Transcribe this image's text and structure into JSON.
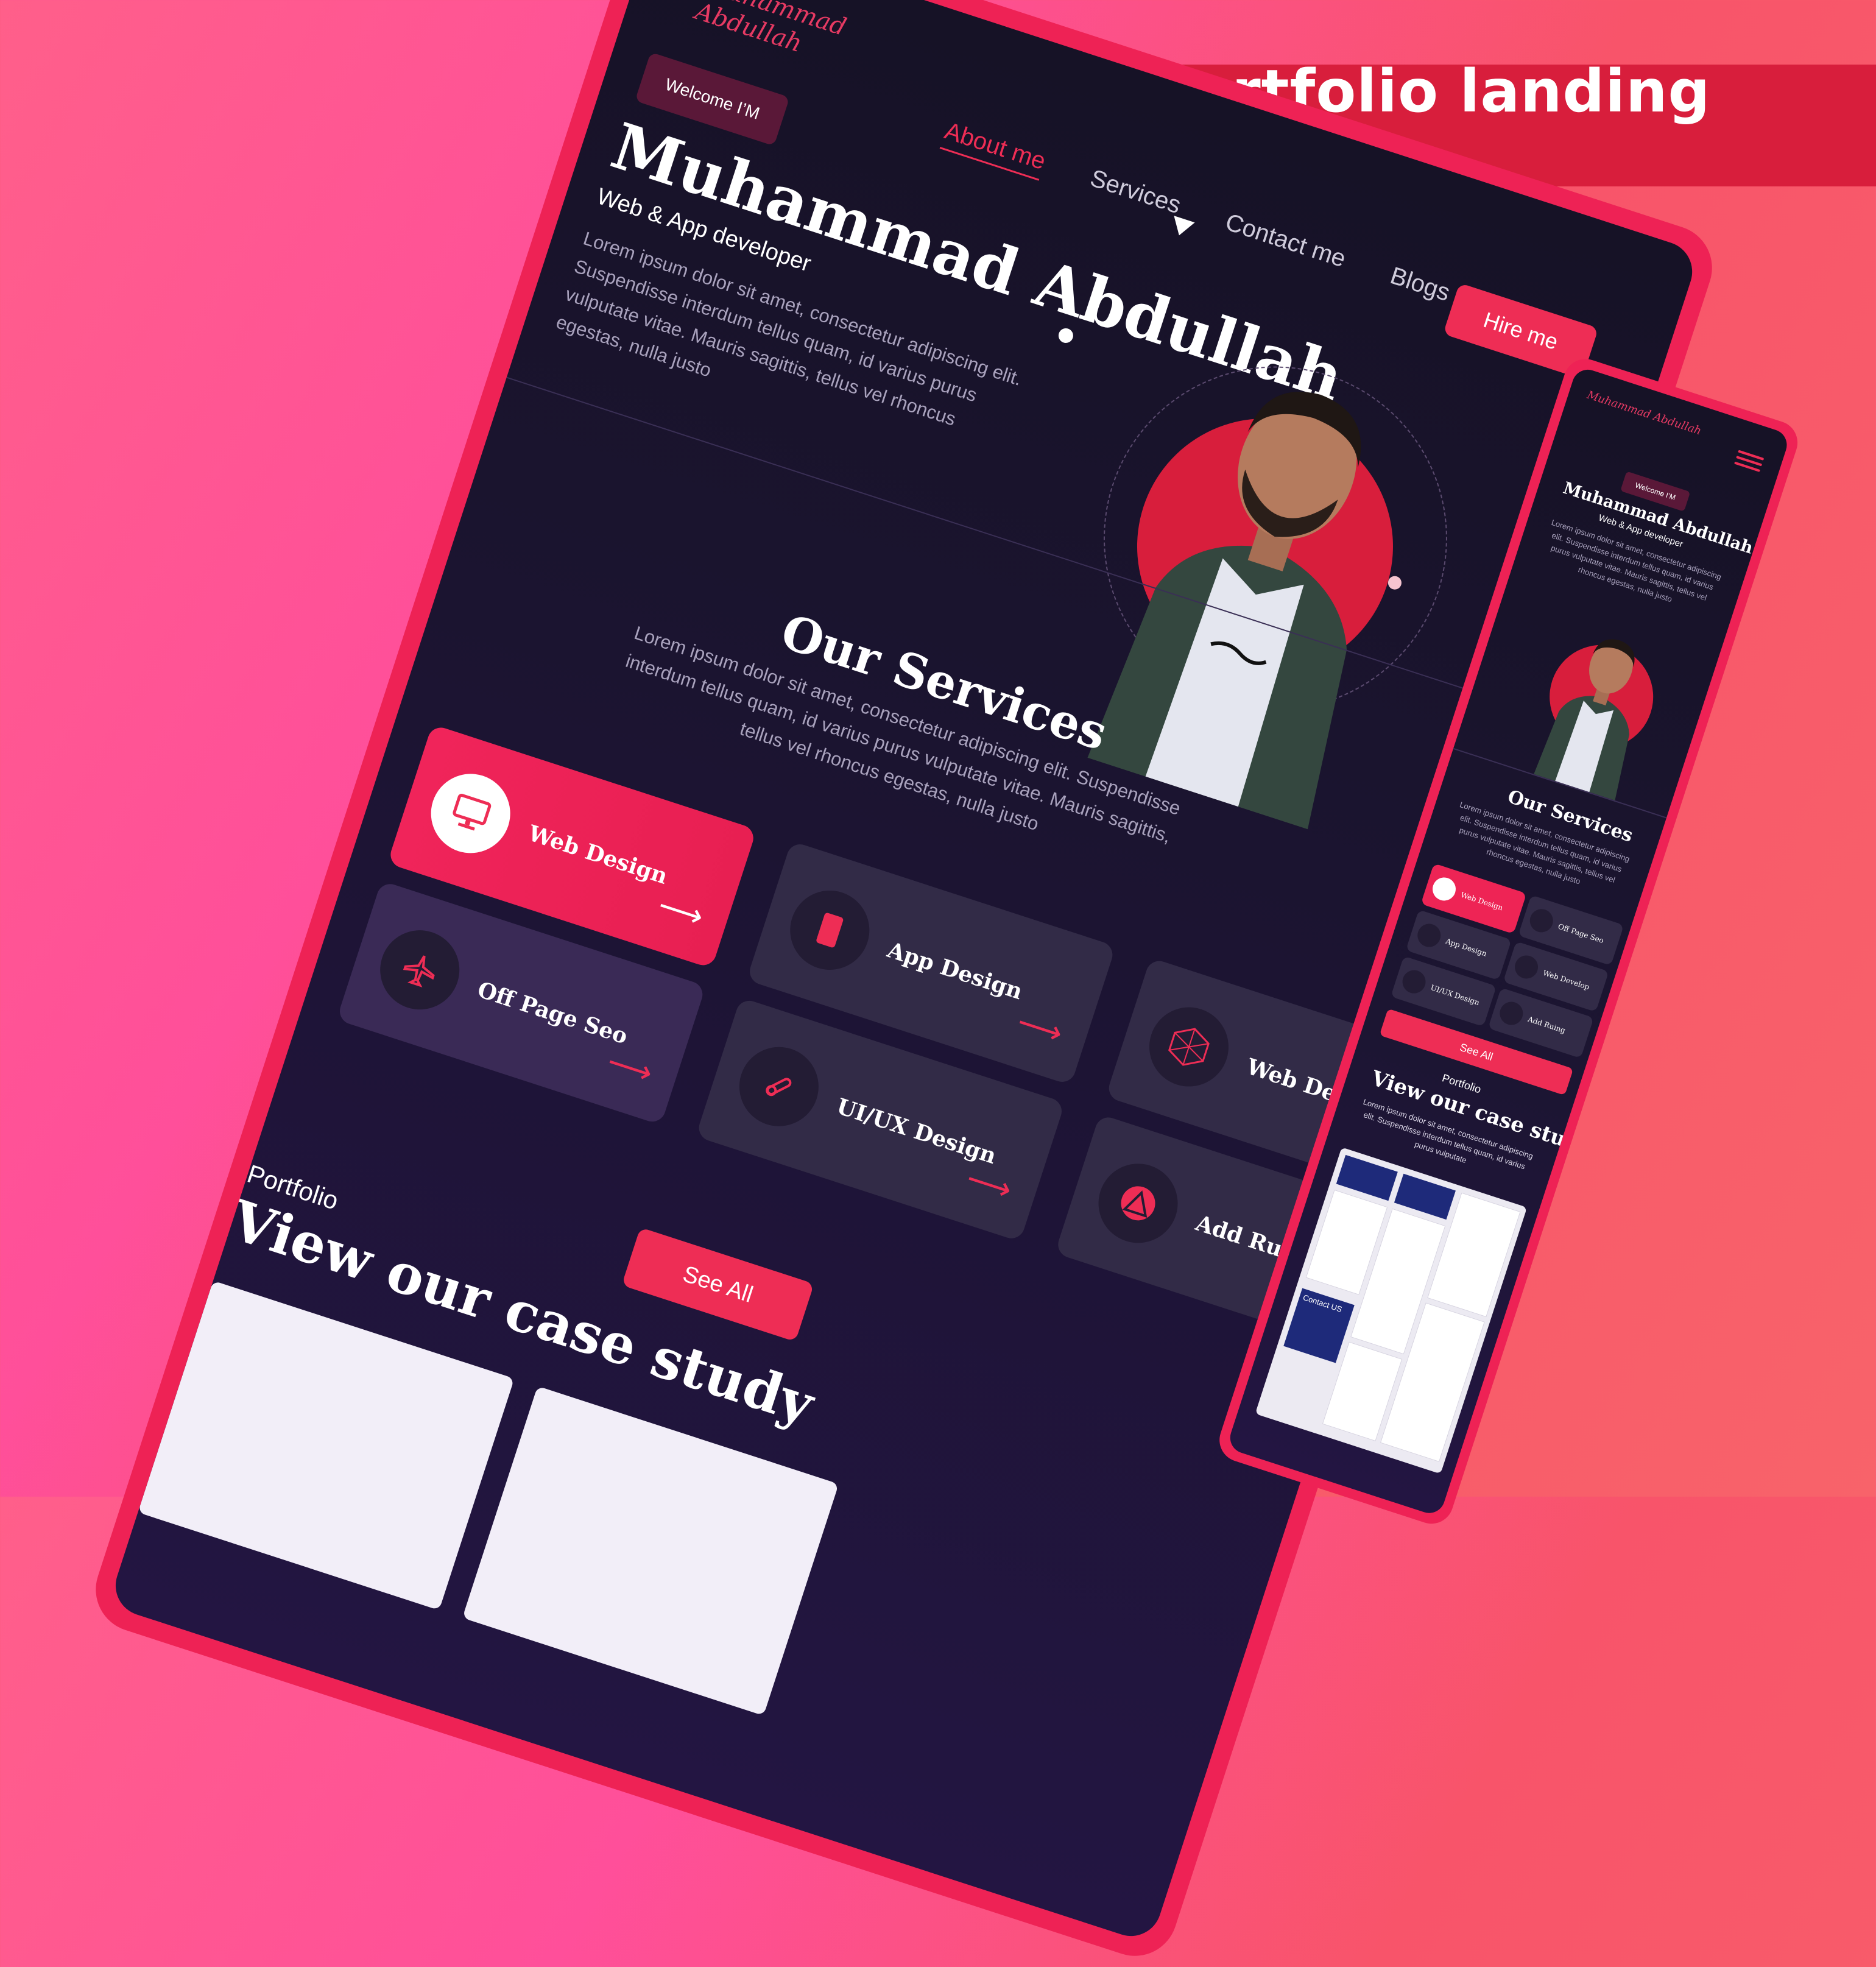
{
  "banner": {
    "text": "Portfolio landing page"
  },
  "colors": {
    "accent": "#ee2d55",
    "background": "#1b1430",
    "card": "#322b47",
    "banner": "#d81e3c"
  },
  "desktop": {
    "logo": "Muhammad Abdullah",
    "nav": [
      "About me",
      "Services",
      "Contact me",
      "Blogs"
    ],
    "hire_button": "Hire me",
    "welcome_badge": "Welcome I’M",
    "name": "Muhammad Abdullah",
    "role": "Web & App developer",
    "description": "Lorem ipsum dolor sit amet, consectetur adipiscing elit. Suspendisse interdum tellus quam, id varius purus vulputate vitae. Mauris sagittis, tellus vel rhoncus egestas, nulla justo",
    "services": {
      "title": "Our Services",
      "description": "Lorem ipsum dolor sit amet, consectetur adipiscing elit. Suspendisse interdum tellus quam, id varius purus vulputate vitae. Mauris sagittis, tellus vel rhoncus egestas, nulla justo",
      "cards": [
        {
          "label": "Web Design",
          "icon": "monitor-icon"
        },
        {
          "label": "App Design",
          "icon": "mobile-icon"
        },
        {
          "label": "Off Page Seo",
          "icon": "airplane-icon"
        },
        {
          "label": "Web Develop",
          "icon": "polyhedron-icon"
        },
        {
          "label": "UI/UX Design",
          "icon": "tools-icon"
        },
        {
          "label": "Add Ruing",
          "icon": "triangle-icon"
        }
      ],
      "see_all": "See All"
    },
    "portfolio": {
      "label": "Portfolio",
      "title": "View our case study"
    }
  },
  "mobile": {
    "logo": "Muhammad Abdullah",
    "welcome_badge": "Welcome I’M",
    "name": "Muhammad Abdullah",
    "role": "Web & App developer",
    "description": "Lorem ipsum dolor sit amet, consectetur adipiscing elit. Suspendisse interdum tellus quam, id varius purus vulputate vitae. Mauris sagittis, tellus vel rhoncus egestas, nulla justo",
    "services_title": "Our Services",
    "services_description": "Lorem ipsum dolor sit amet, consectetur adipiscing elit. Suspendisse interdum tellus quam, id varius purus vulputate vitae. Mauris sagittis, tellus vel rhoncus egestas, nulla justo",
    "cards": [
      "Web Design",
      "Off Page Seo",
      "App Design",
      "Web Develop",
      "UI/UX Design",
      "Add Ruing"
    ],
    "see_all": "See All",
    "portfolio_label": "Portfolio",
    "portfolio_title": "View our case study",
    "portfolio_description": "Lorem ipsum dolor sit amet, consectetur adipiscing elit. Suspendisse interdum tellus quam, id varius purus vulputate",
    "thumb_text": "Contact US"
  }
}
